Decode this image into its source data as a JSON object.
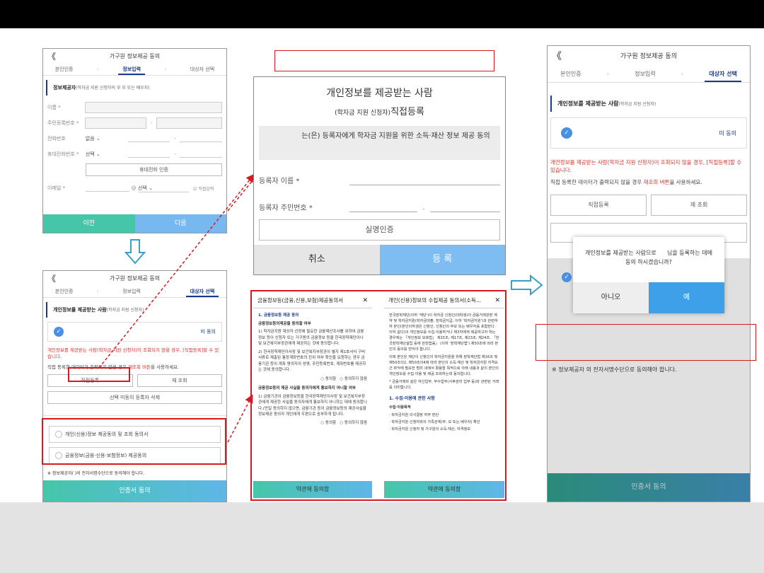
{
  "p1": {
    "title": "가구원 정보제공 동의",
    "back": "《",
    "steps": [
      "본인인증",
      "정보입력",
      "대상자 선택"
    ],
    "section": "정보제공자",
    "section_note": "(학자금 지원 신청자의 부 모 또는 배우자)",
    "fields": {
      "name": "이름 *",
      "rrn": "주민등록번호 *",
      "phone": "전화번호",
      "mobile": "휴대전화번호 *",
      "email": "이메일 *"
    },
    "phone_select": "없음",
    "mobile_select": "선택",
    "dash": "-",
    "verify_btn": "휴대전화 인증",
    "at": "@",
    "email_select": "선택",
    "direct_input": "직접입력",
    "prev": "이전",
    "next": "다음"
  },
  "p2": {
    "title": "가구원 정보제공 동의",
    "steps": [
      "본인인증",
      "정보입력",
      "대상자 선택"
    ],
    "section": "개인정보를 제공받는 사람",
    "section_note": "(학자금 지원 신청자)",
    "disagree": "미 동의",
    "warn": "개인정보를 제공받는 사람(학자금 지원 신청자)이 조회되지 않을 경우, [직접등록]할 수 있습니다.",
    "note_a": "직접 등록한 데이터가 출력되지 않을 경우 ",
    "note_b": "재조회 버튼",
    "note_c": "을 사용하세요.",
    "direct_btn": "직접등록",
    "requery_btn": "재 조회",
    "delete_btn": "선택 미동의 등록자 삭제",
    "consent1": "개인(신용)정보 제공동의 및 조회 동의서",
    "consent2": "금융정보(금융·신용·보험정보) 제공동의",
    "footnote": "※ 정보제공자(      )의 전자서명수단으로 동의해야 합니다.",
    "submit": "인증서 동의"
  },
  "reg": {
    "title": "개인정보를 제공받는 사람",
    "subtitle_small": "(학자금 지원 신청자)",
    "subtitle_big": "직접등록",
    "info": "는(은) 등록자에게 학자금 지원을 위한 소득·재산 정보 제공 동의",
    "name_label": "등록자 이름 *",
    "rrn_label": "등록자 주민번호 *",
    "dash": "-",
    "verify": "실명인증",
    "cancel": "취소",
    "register": "등 록"
  },
  "terms1": {
    "title": "금융정보등(금융,신용,보험)제공동의서",
    "close": "✕",
    "h1": "1. 금융정보등 제공 동의",
    "h2": "금융정보등의제공을 동의할 여부",
    "p1": "1) 학자금지원 대상자 선정에 필요한 금융재산조사를 위하여 금융정보 등이 신청자 또는 가구원의 금융정보 등을 한국장학재단이나 및 보건복지부장관에게 제공하는 것에 동의합니다.",
    "p2": "2) 한국장학재단이사장 및 보건복지부장관이 별지 제1호서식 구비서류로 제출된 통장계좌번호의 진위 여부 확인을 요청하는 경우 금융기관 등이 계좌 명의자의 성명, 주민등록번호, 계좌번호를 제공하는 것에 동의합니다.",
    "agree": "동의함",
    "disagree": "동의하지 않음",
    "h3": "금융정보등의 제공 사실을 동의자에게 통보하지 아니할 여부",
    "p3": "1) 금융기관이 금융정보등을 한국장학재단이사장 및 보건복지부장관에게 제공한 사실을 동의자에게 통보하지 아니하는 데에 동의합니다.(만일 동의하지 않으면, 금융기관 등이 금융정보등의 제공사실을 정보제공 동의자 개인에게 우편으로 송부하게 됩니다.",
    "agree2": "동의함",
    "disagree2": "동의하지 않음",
    "btn": "약관에 동의함"
  },
  "terms2": {
    "title": "개인(신용)정보의 수집제공 동의서(소득...",
    "close": "✕",
    "p1": "한국장학재단(이하 '재단')이 학자금 신청인(대학생)의 금융거래관련 계약 및 학자금지원(학자금대출, 장학금지급, 이하 '학자금지원')과 관련하여 본인(본인이하생은 신청인, 신청인의 부모 또는 배우자를 포함한다. 이하 같다)의 개인정보를 수집·이용하거나 제3자에게 제공하고자 하는 경우에는 「개인정보 보호법」 제15조, 제17조, 제23조, 제24조, 「한국장학재단설립 등에 관한법률」 (이하 '장학재단법') 제50조에 따라 본인의 동의를 얻어야 합니다.",
    "p2": "이에 본인은 재단이 신청인의 학자금지원을 위해 장학재단법 제16조 및 제50조의2, 제50조의4에 따라 본인의 소득·재산 및 학자금지원 자격요건 파악에 필요한 범위 내에서 활용할 목적으로 아래 내용과 같이 본인의 개인정보를 수집·이용 및 제공·조회하는데 동의합니다.",
    "p3": "* 금융거래와 같은 여신업무, 부수업무(사후관리 업무 등)와 관련된 거래를 의미합니다.",
    "h1": "1. 수집·이용에 관한 사항",
    "h2": "수집·이용목적",
    "b1": "· 학자금지원 의사결정 여부 판단",
    "b2": "· 학자금지원 신청자와의 가족관계(부, 모 또는 배우자) 확인",
    "b3": "· 학자금지원 신청자 및 가구원의 소득·재산, 자격정보",
    "btn": "약관에 동의함"
  },
  "p3": {
    "title": "가구원 정보제공 동의",
    "back": "《",
    "steps": [
      "본인인증",
      "정보입력",
      "대상자 선택"
    ],
    "section": "개인정보를 제공받는 사람",
    "section_note": "(학자금 지원 신청자)",
    "disagree": "미 동의",
    "warn": "개인정보를 제공받는 사람(학자금 지원 신청자)이 조회되지 않을 경우, [직접등록]할 수 있습니다.",
    "note_a": "직접 등록한 데이터가 출력되지 않을 경우 ",
    "note_b": "재조회 버튼",
    "note_c": "을 사용하세요.",
    "direct_btn": "직접등록",
    "requery_btn": "재 조회",
    "dialog_a": "개인정보를 제공받는 사람으로",
    "dialog_b": "님을 등록하는 데에",
    "dialog_c": "동의 하시겠습니까?",
    "no": "아니오",
    "yes": "예",
    "footnote": "※ 정보제공자        의 전자서명수단으로 동의해야 합니다.",
    "submit": "인증서 동의"
  },
  "colors": {
    "accent": "#1a3a8c",
    "highlight": "#d71920",
    "green": "#45c6a9",
    "blue": "#78b8f0"
  }
}
